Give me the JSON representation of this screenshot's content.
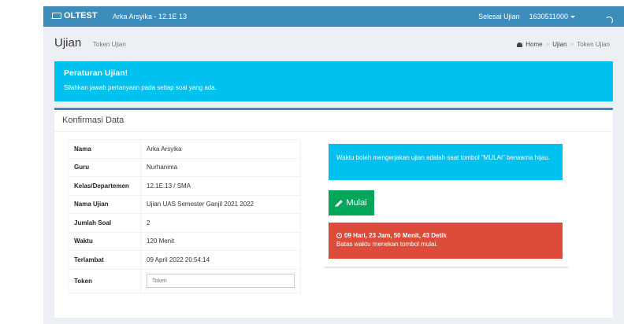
{
  "navbar": {
    "brand": "OLTEST",
    "user_info": "Arka Arsyika - 12.1E 13",
    "finish_label": "Selesai Ujian",
    "user_id": "1630511000"
  },
  "header": {
    "title": "Ujian",
    "subtitle": "Token Ujian",
    "breadcrumb": {
      "home": "Home",
      "item1": "Ujian",
      "item2": "Token Ujian"
    }
  },
  "callout": {
    "title": "Peraturan Ujian!",
    "text": "Silahkan jawab pertanyaan pada setiap soal yang ada."
  },
  "box": {
    "title": "Konfirmasi Data",
    "rows": [
      {
        "label": "Nama",
        "value": "Arka Arsyika"
      },
      {
        "label": "Guru",
        "value": "Nurhanima"
      },
      {
        "label": "Kelas/Departemen",
        "value": "12.1E.13 / SMA"
      },
      {
        "label": "Nama Ujian",
        "value": "Ujian UAS Semester Ganjil 2021 2022"
      },
      {
        "label": "Jumlah Soal",
        "value": "2"
      },
      {
        "label": "Waktu",
        "value": "120 Menit"
      },
      {
        "label": "Terlambat",
        "value": "09 April 2022 20:54:14"
      }
    ],
    "token_label": "Token",
    "token_placeholder": "Token"
  },
  "panel": {
    "info_text": "Waktu boleh mengerjakan ujian adalah saat tombol \"MULAI\" berwarna hijau.",
    "start_button": "Mulai",
    "countdown": "09 Hari, 23 Jam, 50 Menit, 43 Detik",
    "deadline_note": "Batas waktu menekan tombol mulai."
  },
  "colors": {
    "primary": "#3c8dbc",
    "info": "#00c0ef",
    "success": "#00a65a",
    "danger": "#dd4b39",
    "background": "#ecf0f5"
  },
  "icons": [
    "laptop-icon",
    "caret-down-icon",
    "dashboard-icon",
    "pencil-icon",
    "clock-icon",
    "spinner-icon"
  ]
}
